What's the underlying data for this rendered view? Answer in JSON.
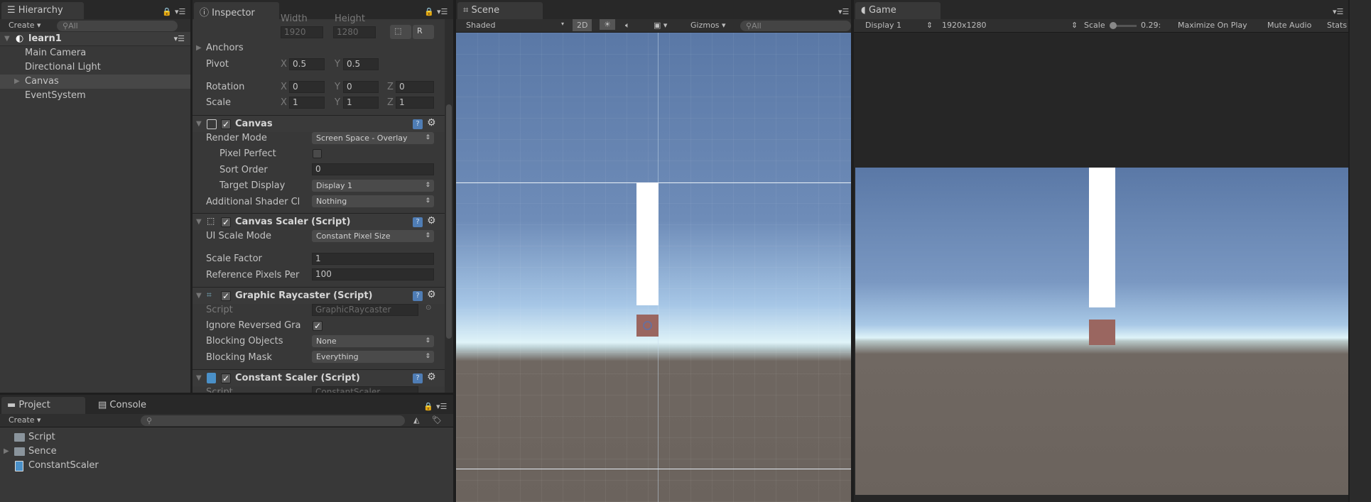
{
  "hierarchy": {
    "tab": "Hierarchy",
    "create": "Create",
    "search": "All",
    "scene": "learn1",
    "items": [
      "Main Camera",
      "Directional Light",
      "Canvas",
      "EventSystem"
    ],
    "selected": "Canvas"
  },
  "inspector": {
    "tab": "Inspector",
    "rect": {
      "width_label": "Width",
      "height_label": "Height",
      "width": "1920",
      "height": "1280",
      "r_button": "R",
      "anchors": "Anchors",
      "pivot": "Pivot",
      "pivot_x": "0.5",
      "pivot_y": "0.5",
      "rotation": "Rotation",
      "rot_x": "0",
      "rot_y": "0",
      "rot_z": "0",
      "scale": "Scale",
      "scale_x": "1",
      "scale_y": "1",
      "scale_z": "1",
      "x": "X",
      "y": "Y",
      "z": "Z"
    },
    "canvas": {
      "title": "Canvas",
      "render_mode_label": "Render Mode",
      "render_mode": "Screen Space - Overlay",
      "pixel_perfect_label": "Pixel Perfect",
      "pixel_perfect": false,
      "sort_order_label": "Sort Order",
      "sort_order": "0",
      "target_display_label": "Target Display",
      "target_display": "Display 1",
      "shader_label": "Additional Shader Cl",
      "shader": "Nothing"
    },
    "canvas_scaler": {
      "title": "Canvas Scaler (Script)",
      "mode_label": "UI Scale Mode",
      "mode": "Constant Pixel Size",
      "factor_label": "Scale Factor",
      "factor": "1",
      "ref_label": "Reference Pixels Per",
      "ref": "100"
    },
    "raycaster": {
      "title": "Graphic Raycaster (Script)",
      "script_label": "Script",
      "script": "GraphicRaycaster",
      "ignore_label": "Ignore Reversed Gra",
      "ignore": true,
      "objects_label": "Blocking Objects",
      "objects": "None",
      "mask_label": "Blocking Mask",
      "mask": "Everything"
    },
    "constant_scaler": {
      "title": "Constant Scaler (Script)",
      "script_label": "Script",
      "script": "ConstantScaler"
    }
  },
  "scene": {
    "tab": "Scene",
    "shading": "Shaded",
    "mode_2d": "2D",
    "gizmos": "Gizmos",
    "search": "All"
  },
  "game": {
    "tab": "Game",
    "display": "Display 1",
    "resolution": "1920x1280",
    "scale_label": "Scale",
    "scale": "0.29:",
    "maximize": "Maximize On Play",
    "mute": "Mute Audio",
    "stats": "Stats"
  },
  "project": {
    "tab": "Project",
    "console_tab": "Console",
    "create": "Create",
    "items": [
      {
        "name": "Script",
        "icon": "folder-icon"
      },
      {
        "name": "Sence",
        "icon": "folder-icon"
      },
      {
        "name": "ConstantScaler",
        "icon": "csharp-script-icon"
      }
    ]
  },
  "colors": {
    "sky_top": "#5a78a6",
    "horizon": "#dff3f8",
    "ground": "#6b635d",
    "bar": "#ffffff",
    "square": "#9a6660"
  }
}
